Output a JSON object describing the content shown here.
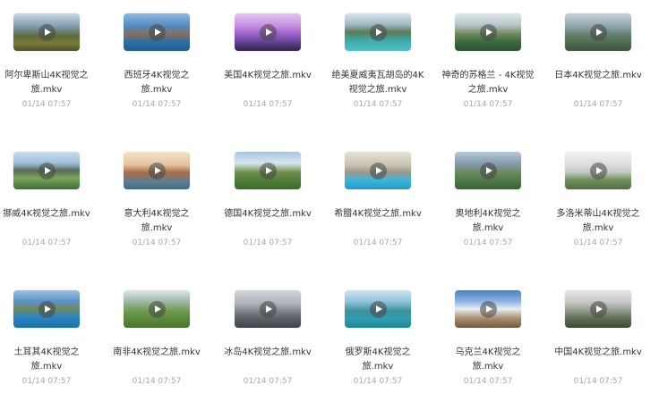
{
  "files": [
    {
      "name": "阿尔卑斯山4K视觉之旅.mkv",
      "date": "01/14 07:57",
      "icon": "play-icon",
      "bg": "linear-gradient(180deg,#c9d8e6 0%,#7f9bb0 35%,#5d6b3a 60%,#7a7a38 80%,#4c5228 100%)"
    },
    {
      "name": "西班牙4K视觉之旅.mkv",
      "date": "01/14 07:57",
      "icon": "play-icon",
      "bg": "linear-gradient(180deg,#8fb9dd 0%,#4f89c0 35%,#8a6f5a 55%,#2e6fa6 75%,#1f5d92 100%)"
    },
    {
      "name": "美国4K视觉之旅.mkv",
      "date": "01/14 07:57",
      "icon": "play-icon",
      "bg": "linear-gradient(180deg,#e2c7f0 0%,#c48ae0 35%,#9b5fc9 55%,#5a3f86 80%,#2f2450 100%)"
    },
    {
      "name": "绝美夏威夷瓦胡岛的4K视觉之旅.mkv",
      "date": "01/14 07:57",
      "icon": "play-icon",
      "bg": "linear-gradient(180deg,#d6e4ec 0%,#9fb8c2 30%,#5c7a55 50%,#3fa7a8 70%,#4fc1c2 100%)"
    },
    {
      "name": "神奇的苏格兰 - 4K视觉之旅.mkv",
      "date": "01/14 07:57",
      "icon": "play-icon",
      "bg": "linear-gradient(180deg,#dfe6ea 0%,#b8c6cc 30%,#6f8a5a 55%,#3d6b3f 75%,#2f4f33 100%)"
    },
    {
      "name": "日本4K视觉之旅.mkv",
      "date": "01/14 07:57",
      "icon": "play-icon",
      "bg": "linear-gradient(180deg,#c6d3d9 0%,#8ea3a9 35%,#5e7d64 60%,#4c6a4f 80%,#3b5541 100%)"
    },
    {
      "name": "挪威4K视觉之旅.mkv",
      "date": "01/14 07:57",
      "icon": "play-icon",
      "bg": "linear-gradient(180deg,#c9dceb 0%,#9fbfd9 30%,#5a6a5a 50%,#7aa55a 70%,#3f6f3a 100%)"
    },
    {
      "name": "意大利4K视觉之旅.mkv",
      "date": "01/14 07:57",
      "icon": "play-icon",
      "bg": "linear-gradient(180deg,#f3e2cc 0%,#e4c29a 35%,#a86c4a 55%,#5d7f92 80%,#3f6b86 100%)"
    },
    {
      "name": "德国4K视觉之旅.mkv",
      "date": "01/14 07:57",
      "icon": "play-icon",
      "bg": "linear-gradient(180deg,#a7c6e0 0%,#d7e6ef 30%,#6f8f4a 55%,#4f7f3a 75%,#3b6a2c 100%)"
    },
    {
      "name": "希腊4K视觉之旅.mkv",
      "date": "01/14 07:57",
      "icon": "play-icon",
      "bg": "linear-gradient(180deg,#e6e1d6 0%,#c9c2b3 35%,#9e978a 55%,#3fb6d9 75%,#1f9cc8 100%)"
    },
    {
      "name": "奥地利4K视觉之旅.mkv",
      "date": "01/14 07:57",
      "icon": "play-icon",
      "bg": "linear-gradient(180deg,#b9c7d3 0%,#7f97a8 35%,#6b8a5a 55%,#4f7a4a 75%,#3d6139 100%)"
    },
    {
      "name": "多洛米蒂山4K视觉之旅.mkv",
      "date": "01/14 07:57",
      "icon": "play-icon",
      "bg": "linear-gradient(180deg,#f2f2f2 0%,#dcdcdc 35%,#bfc7bf 55%,#6f8f5a 75%,#556f44 100%)"
    },
    {
      "name": "土耳其4K视觉之旅.mkv",
      "date": "01/14 07:57",
      "icon": "play-icon",
      "bg": "linear-gradient(180deg,#9cc2e5 0%,#5b92c8 30%,#6f8a5a 50%,#2e86c1 70%,#1c6fa8 100%)"
    },
    {
      "name": "南非4K视觉之旅.mkv",
      "date": "01/14 07:57",
      "icon": "play-icon",
      "bg": "linear-gradient(180deg,#dbe7ee 0%,#9fb7a5 30%,#6f9a4f 55%,#5f8a3a 75%,#4a7230 100%)"
    },
    {
      "name": "冰岛4K视觉之旅.mkv",
      "date": "01/14 07:57",
      "icon": "play-icon",
      "bg": "linear-gradient(180deg,#d3d6d9 0%,#aeb3b8 35%,#7f858a 55%,#5b6166 75%,#3f4347 100%)"
    },
    {
      "name": "俄罗斯4K视觉之旅.mkv",
      "date": "01/14 07:57",
      "icon": "play-icon",
      "bg": "linear-gradient(180deg,#cfe4ef 0%,#8fc2d9 30%,#3f8f9f 55%,#2f9fae 75%,#1f8696 100%)"
    },
    {
      "name": "乌克兰4K视觉之旅.mkv",
      "date": "01/14 07:57",
      "icon": "play-icon",
      "bg": "linear-gradient(180deg,#4a7fc2 0%,#8fb5e2 30%,#e9eef4 50%,#a88d6b 75%,#6f5a3f 100%)"
    },
    {
      "name": "中国4K视觉之旅.mkv",
      "date": "01/14 07:57",
      "icon": "play-icon",
      "bg": "linear-gradient(180deg,#e6e6e6 0%,#c9c9c9 30%,#8f9a88 55%,#5f6f52 75%,#3f4a37 100%)"
    }
  ]
}
